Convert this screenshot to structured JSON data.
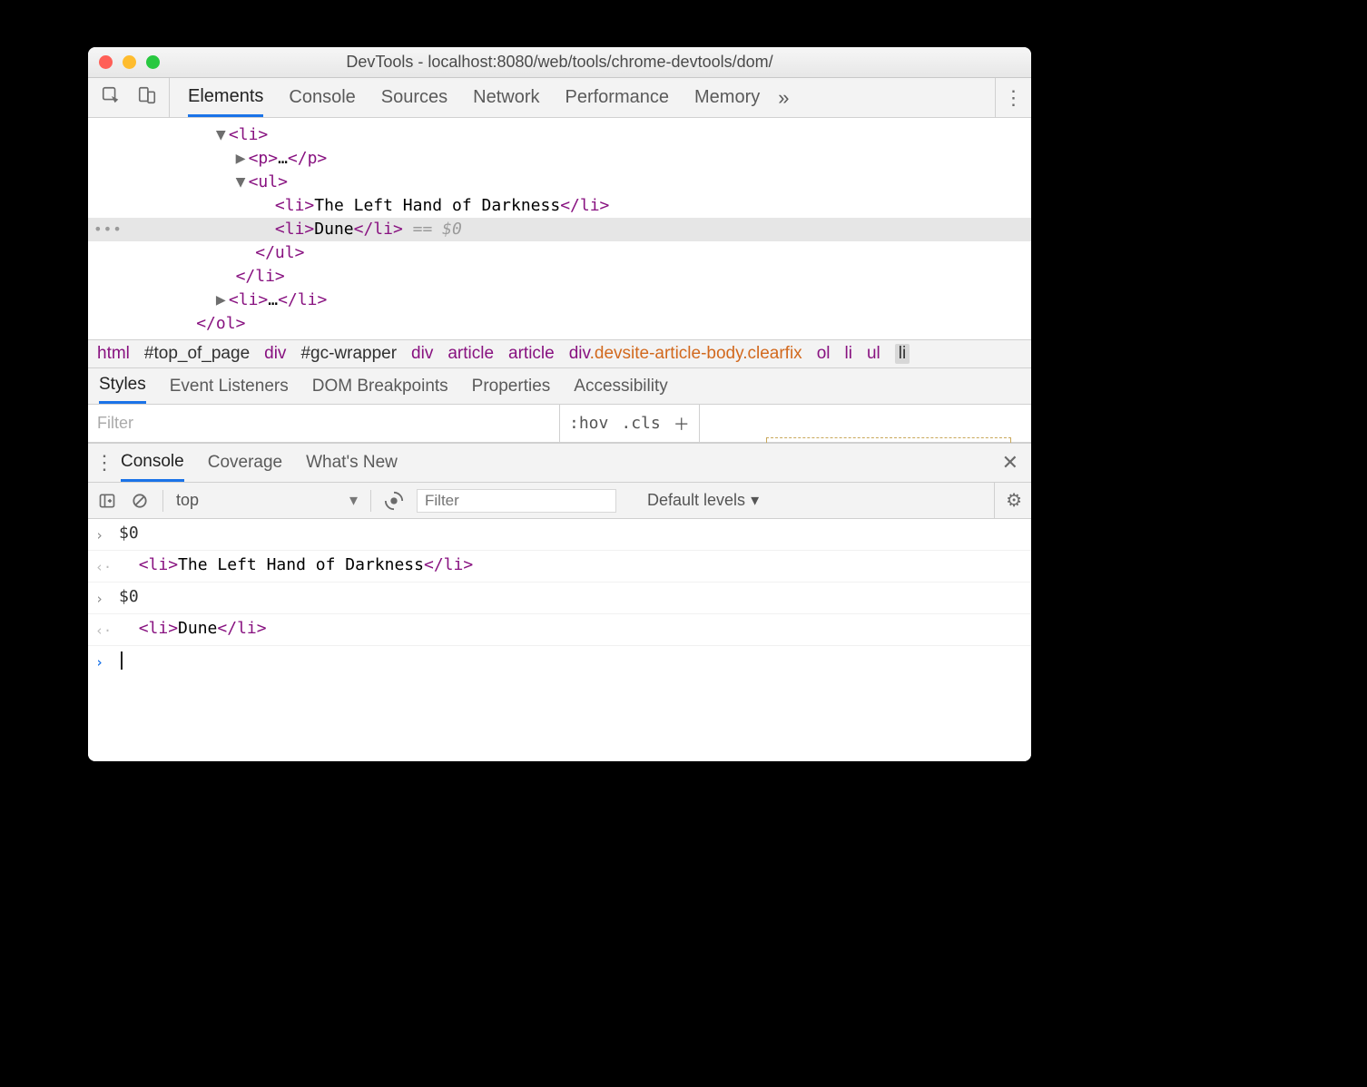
{
  "window": {
    "title": "DevTools - localhost:8080/web/tools/chrome-devtools/dom/"
  },
  "main_tabs": {
    "items": [
      "Elements",
      "Console",
      "Sources",
      "Network",
      "Performance",
      "Memory"
    ],
    "active_index": 0,
    "overflow_glyph": "»"
  },
  "dom_tree": {
    "lines": [
      {
        "indent": "             ",
        "arrow": "▼",
        "tag_open": "<li>",
        "text": "",
        "tag_close": ""
      },
      {
        "indent": "               ",
        "arrow": "▶",
        "tag_open": "<p>",
        "text": "…",
        "tag_close": "</p>"
      },
      {
        "indent": "               ",
        "arrow": "▼",
        "tag_open": "<ul>",
        "text": "",
        "tag_close": ""
      },
      {
        "indent": "                   ",
        "arrow": "",
        "tag_open": "<li>",
        "text": "The Left Hand of Darkness",
        "tag_close": "</li>"
      },
      {
        "indent": "                   ",
        "arrow": "",
        "tag_open": "<li>",
        "text": "Dune",
        "tag_close": "</li>",
        "selected_suffix": " == $0",
        "selected": true
      },
      {
        "indent": "                 ",
        "arrow": "",
        "tag_open": "",
        "text": "",
        "tag_close": "</ul>"
      },
      {
        "indent": "               ",
        "arrow": "",
        "tag_open": "",
        "text": "",
        "tag_close": "</li>"
      },
      {
        "indent": "             ",
        "arrow": "▶",
        "tag_open": "<li>",
        "text": "…",
        "tag_close": "</li>"
      },
      {
        "indent": "           ",
        "arrow": "",
        "tag_open": "",
        "text": "",
        "tag_close": "</ol>"
      }
    ],
    "selected_gutter": "•••"
  },
  "breadcrumb": {
    "items": [
      {
        "text": "html",
        "kind": "tag"
      },
      {
        "text": "#top_of_page",
        "kind": "id"
      },
      {
        "text": "div",
        "kind": "tag"
      },
      {
        "text": "#gc-wrapper",
        "kind": "id"
      },
      {
        "text": "div",
        "kind": "tag"
      },
      {
        "text": "article",
        "kind": "tag"
      },
      {
        "text": "article",
        "kind": "tag"
      },
      {
        "tag": "div",
        "cls": ".devsite-article-body.clearfix",
        "kind": "tagcls"
      },
      {
        "text": "ol",
        "kind": "tag"
      },
      {
        "text": "li",
        "kind": "tag"
      },
      {
        "text": "ul",
        "kind": "tag"
      },
      {
        "text": "li",
        "kind": "tag",
        "last": true
      }
    ]
  },
  "styles_tabs": {
    "items": [
      "Styles",
      "Event Listeners",
      "DOM Breakpoints",
      "Properties",
      "Accessibility"
    ],
    "active_index": 0
  },
  "styles_filter": {
    "placeholder": "Filter",
    "hov": ":hov",
    "cls": ".cls",
    "new": "＋"
  },
  "drawer_tabs": {
    "items": [
      "Console",
      "Coverage",
      "What's New"
    ],
    "active_index": 0
  },
  "console_toolbar": {
    "context": "top",
    "filter_placeholder": "Filter",
    "level": "Default levels"
  },
  "console_rows": [
    {
      "icon": "input",
      "glyph": "›",
      "body_plain": "$0"
    },
    {
      "icon": "output",
      "glyph": "‹·",
      "body_html_indent": "  ",
      "tag_open": "<li>",
      "text": "The Left Hand of Darkness",
      "tag_close": "</li>"
    },
    {
      "icon": "input",
      "glyph": "›",
      "body_plain": "$0"
    },
    {
      "icon": "output",
      "glyph": "‹·",
      "body_html_indent": "  ",
      "tag_open": "<li>",
      "text": "Dune",
      "tag_close": "</li>"
    },
    {
      "icon": "prompt",
      "glyph": "›",
      "cursor": true
    }
  ]
}
